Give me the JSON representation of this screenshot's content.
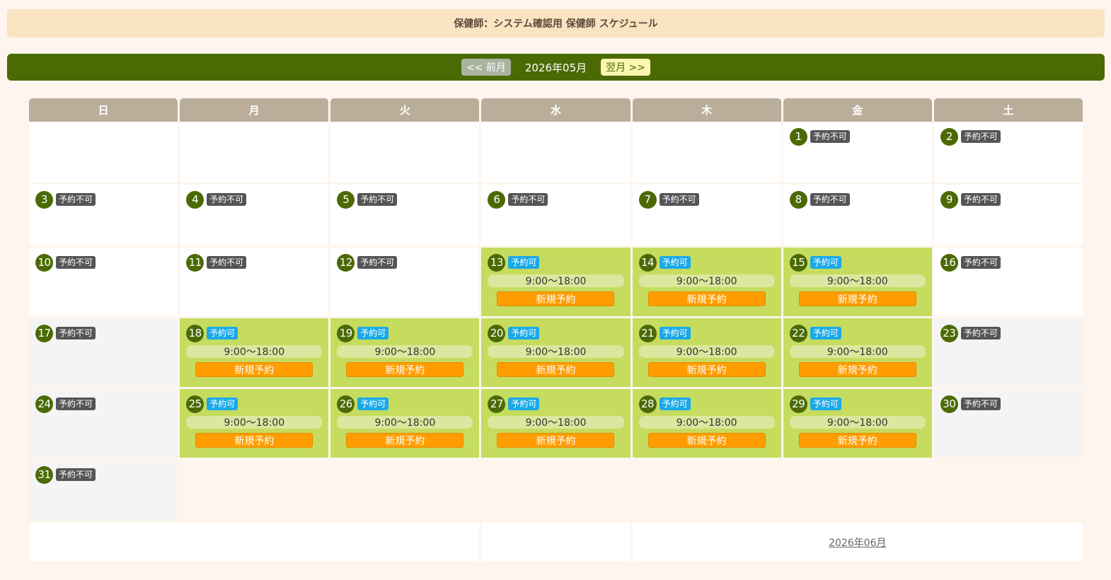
{
  "header": {
    "title": "保健師：システム確認用 保健師 スケジュール"
  },
  "nav": {
    "prev_label": "<< 前月",
    "current_month": "2026年05月",
    "next_label": "翌月 >>"
  },
  "weekdays": [
    "日",
    "月",
    "火",
    "水",
    "木",
    "金",
    "土"
  ],
  "labels": {
    "unavailable": "予約不可",
    "available": "予約可",
    "time": "9:00〜18:00",
    "book": "新規予約"
  },
  "days": [
    {
      "d": "1",
      "ok": false
    },
    {
      "d": "2",
      "ok": false
    },
    {
      "d": "3",
      "ok": false
    },
    {
      "d": "4",
      "ok": false
    },
    {
      "d": "5",
      "ok": false
    },
    {
      "d": "6",
      "ok": false
    },
    {
      "d": "7",
      "ok": false
    },
    {
      "d": "8",
      "ok": false
    },
    {
      "d": "9",
      "ok": false
    },
    {
      "d": "10",
      "ok": false
    },
    {
      "d": "11",
      "ok": false
    },
    {
      "d": "12",
      "ok": false
    },
    {
      "d": "13",
      "ok": true
    },
    {
      "d": "14",
      "ok": true
    },
    {
      "d": "15",
      "ok": true
    },
    {
      "d": "16",
      "ok": false
    },
    {
      "d": "17",
      "ok": false
    },
    {
      "d": "18",
      "ok": true
    },
    {
      "d": "19",
      "ok": true
    },
    {
      "d": "20",
      "ok": true
    },
    {
      "d": "21",
      "ok": true
    },
    {
      "d": "22",
      "ok": true
    },
    {
      "d": "23",
      "ok": false
    },
    {
      "d": "24",
      "ok": false
    },
    {
      "d": "25",
      "ok": true
    },
    {
      "d": "26",
      "ok": true
    },
    {
      "d": "27",
      "ok": true
    },
    {
      "d": "28",
      "ok": true
    },
    {
      "d": "29",
      "ok": true
    },
    {
      "d": "30",
      "ok": false
    },
    {
      "d": "31",
      "ok": false
    }
  ],
  "footer": {
    "next_month_link": "2026年06月"
  },
  "colors": {
    "nav_bg": "#4b6a04",
    "available_bg": "#c5dc5f",
    "book_btn": "#ff9d00",
    "badge_ok": "#1aa9e8",
    "badge_ng": "#555555"
  }
}
